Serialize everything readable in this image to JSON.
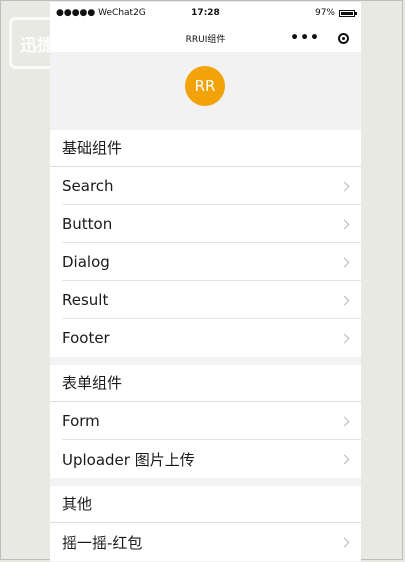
{
  "statusbar": {
    "signal": "●●●●● WeChat2G",
    "time": "17:28",
    "battery": "97%",
    "battery_level": 0.97
  },
  "navbar": {
    "title": "RRUI组件",
    "more": "•••"
  },
  "avatar": {
    "text": "RR"
  },
  "sections": [
    {
      "title": "基础组件",
      "items": [
        "Search",
        "Button",
        "Dialog",
        "Result",
        "Footer"
      ]
    },
    {
      "title": "表单组件",
      "items": [
        "Form",
        "Uploader 图片上传"
      ]
    },
    {
      "title": "其他",
      "items": [
        "摇一摇-红包"
      ]
    }
  ],
  "watermark": {
    "text": "迅捷"
  },
  "colors": {
    "avatar": "#f3a30a",
    "background": "#e9e9e4"
  }
}
